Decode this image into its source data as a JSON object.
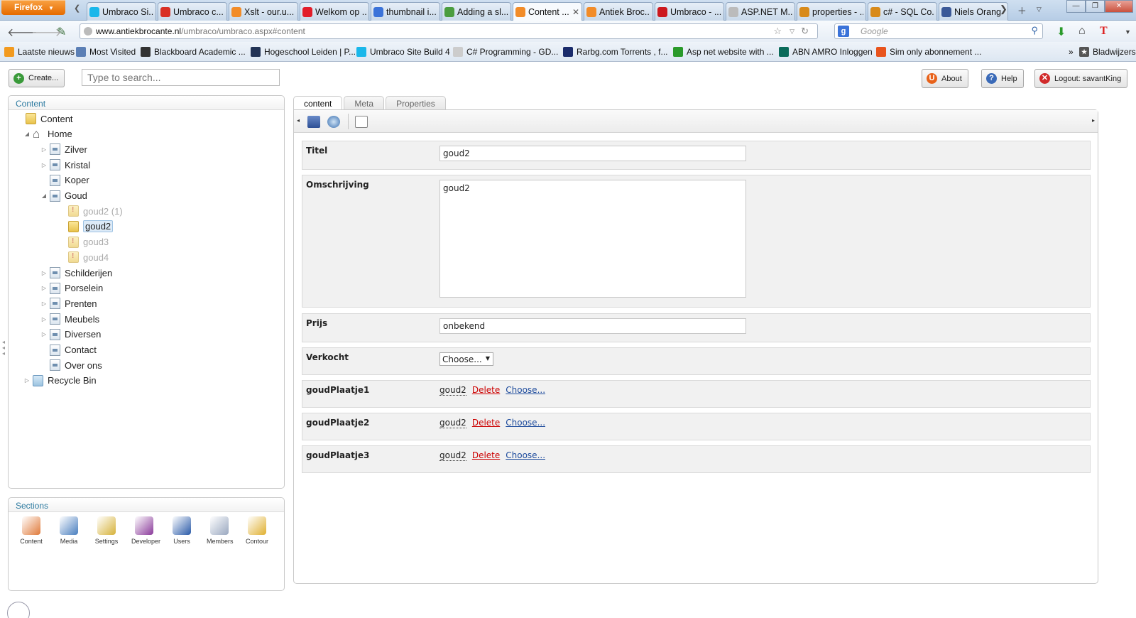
{
  "browser": {
    "menu_label": "Firefox",
    "tabs": [
      {
        "title": "Umbraco Si...",
        "icon": "vimeo-icon",
        "color": "#1ab7ea"
      },
      {
        "title": "Umbraco c...",
        "icon": "gmail-icon",
        "color": "#d93025"
      },
      {
        "title": "Xslt - our.u...",
        "icon": "umbraco-icon",
        "color": "#f28c28"
      },
      {
        "title": "Welkom op ...",
        "icon": "blackboard-icon",
        "color": "#e21d2a"
      },
      {
        "title": "thumbnail i...",
        "icon": "google-icon",
        "color": "#3b73d9"
      },
      {
        "title": "Adding a sl...",
        "icon": "windows-icon",
        "color": "#4b9d3f"
      },
      {
        "title": "Content ...",
        "icon": "umbraco-icon",
        "color": "#f28c28",
        "active": true
      },
      {
        "title": "Antiek Broc...",
        "icon": "umbraco-icon",
        "color": "#f28c28"
      },
      {
        "title": "Umbraco - ...",
        "icon": "youtube-icon",
        "color": "#cc181e"
      },
      {
        "title": "ASP.NET M...",
        "icon": "page-icon",
        "color": "#bbbbbb"
      },
      {
        "title": "properties - ...",
        "icon": "stackoverflow-icon",
        "color": "#d88a1a"
      },
      {
        "title": "c# - SQL Co...",
        "icon": "stackoverflow-icon",
        "color": "#d88a1a"
      },
      {
        "title": "Niels Orang",
        "icon": "facebook-icon",
        "color": "#3b5998"
      }
    ],
    "url_domain": "www.antiekbrocante.nl",
    "url_path": "/umbraco/umbraco.aspx#content",
    "search_engine_letter": "g",
    "search_placeholder": "Google",
    "user_letter": "T",
    "bookmarks": [
      {
        "label": "Laatste nieuws",
        "icon": "rss-icon",
        "color": "#f29a1f"
      },
      {
        "label": "Most Visited",
        "icon": "most-visited-icon",
        "color": "#5b7fb5"
      },
      {
        "label": "Blackboard Academic ...",
        "icon": "blackboard-icon",
        "color": "#333333"
      },
      {
        "label": "Hogeschool Leiden | P...",
        "icon": "hogeschool-icon",
        "color": "#223355"
      },
      {
        "label": "Umbraco Site Build 4",
        "icon": "vimeo-icon",
        "color": "#1ab7ea"
      },
      {
        "label": "C# Programming - GD...",
        "icon": "page-icon",
        "color": "#cccccc"
      },
      {
        "label": "Rarbg.com Torrents , f...",
        "icon": "rarbg-icon",
        "color": "#1a2b6b"
      },
      {
        "label": "Asp net website with ...",
        "icon": "download-icon",
        "color": "#2a9a2a"
      },
      {
        "label": "ABN AMRO Inloggen",
        "icon": "abnamro-icon",
        "color": "#0a6b5a"
      },
      {
        "label": "Sim only abonnement ...",
        "icon": "simonly-icon",
        "color": "#e8531c"
      }
    ],
    "bookmarks_overflow": "»",
    "bookmarks_menu_label": "Bladwijzers"
  },
  "umbraco": {
    "create_label": "Create...",
    "search_placeholder": "Type to search...",
    "about_label": "About",
    "help_label": "Help",
    "logout_label": "Logout: savantKing",
    "content_panel_title": "Content",
    "tree": [
      {
        "label": "Content",
        "icon": "folder-icon",
        "level": 0,
        "arrow": "",
        "faded": false
      },
      {
        "label": "Home",
        "icon": "home-icon",
        "level": 1,
        "arrow": "expanded",
        "faded": false
      },
      {
        "label": "Zilver",
        "icon": "doc-icon",
        "level": 2,
        "arrow": "collapsed",
        "faded": false
      },
      {
        "label": "Kristal",
        "icon": "doc-icon",
        "level": 2,
        "arrow": "collapsed",
        "faded": false
      },
      {
        "label": "Koper",
        "icon": "doc-icon",
        "level": 2,
        "arrow": "",
        "faded": false
      },
      {
        "label": "Goud",
        "icon": "doc-icon",
        "level": 2,
        "arrow": "expanded",
        "faded": false
      },
      {
        "label": "goud2 (1)",
        "icon": "folder-icon",
        "level": 3,
        "arrow": "",
        "faded": true
      },
      {
        "label": "goud2",
        "icon": "folder-icon",
        "level": 3,
        "arrow": "",
        "faded": false,
        "selected": true
      },
      {
        "label": "goud3",
        "icon": "folder-icon",
        "level": 3,
        "arrow": "",
        "faded": true
      },
      {
        "label": "goud4",
        "icon": "folder-icon",
        "level": 3,
        "arrow": "",
        "faded": true
      },
      {
        "label": "Schilderijen",
        "icon": "doc-icon",
        "level": 2,
        "arrow": "collapsed",
        "faded": false
      },
      {
        "label": "Porselein",
        "icon": "doc-icon",
        "level": 2,
        "arrow": "collapsed",
        "faded": false
      },
      {
        "label": "Prenten",
        "icon": "doc-icon",
        "level": 2,
        "arrow": "collapsed",
        "faded": false
      },
      {
        "label": "Meubels",
        "icon": "doc-icon",
        "level": 2,
        "arrow": "collapsed",
        "faded": false
      },
      {
        "label": "Diversen",
        "icon": "doc-icon",
        "level": 2,
        "arrow": "collapsed",
        "faded": false
      },
      {
        "label": "Contact",
        "icon": "doc-icon",
        "level": 2,
        "arrow": "",
        "faded": false
      },
      {
        "label": "Over ons",
        "icon": "doc-icon",
        "level": 2,
        "arrow": "",
        "faded": false
      },
      {
        "label": "Recycle Bin",
        "icon": "recycle-bin-icon",
        "level": 1,
        "arrow": "collapsed",
        "faded": false
      }
    ],
    "sections_title": "Sections",
    "sections": [
      {
        "label": "Content",
        "icon": "content-section-icon",
        "color": "#e07a3a"
      },
      {
        "label": "Media",
        "icon": "media-section-icon",
        "color": "#4a7fbf"
      },
      {
        "label": "Settings",
        "icon": "settings-section-icon",
        "color": "#d6b23a"
      },
      {
        "label": "Developer",
        "icon": "developer-section-icon",
        "color": "#8a3a9a"
      },
      {
        "label": "Users",
        "icon": "users-section-icon",
        "color": "#2a5aa8"
      },
      {
        "label": "Members",
        "icon": "members-section-icon",
        "color": "#9aa8c0"
      },
      {
        "label": "Contour",
        "icon": "contour-section-icon",
        "color": "#e0b030"
      }
    ],
    "editor_tabs": [
      {
        "label": "content",
        "active": true
      },
      {
        "label": "Meta",
        "active": false
      },
      {
        "label": "Properties",
        "active": false
      }
    ],
    "toolbar": [
      "save-icon",
      "save-and-publish-icon",
      "preview-icon"
    ],
    "properties": {
      "titel": {
        "label": "Titel",
        "value": "goud2"
      },
      "omschrijving": {
        "label": "Omschrijving",
        "value": "goud2"
      },
      "prijs": {
        "label": "Prijs",
        "value": "onbekend"
      },
      "verkocht": {
        "label": "Verkocht",
        "value": "Choose..."
      },
      "media": [
        {
          "label": "goudPlaatje1",
          "name": "goud2",
          "delete": "Delete",
          "choose": "Choose..."
        },
        {
          "label": "goudPlaatje2",
          "name": "goud2",
          "delete": "Delete",
          "choose": "Choose..."
        },
        {
          "label": "goudPlaatje3",
          "name": "goud2",
          "delete": "Delete",
          "choose": "Choose..."
        }
      ]
    }
  }
}
